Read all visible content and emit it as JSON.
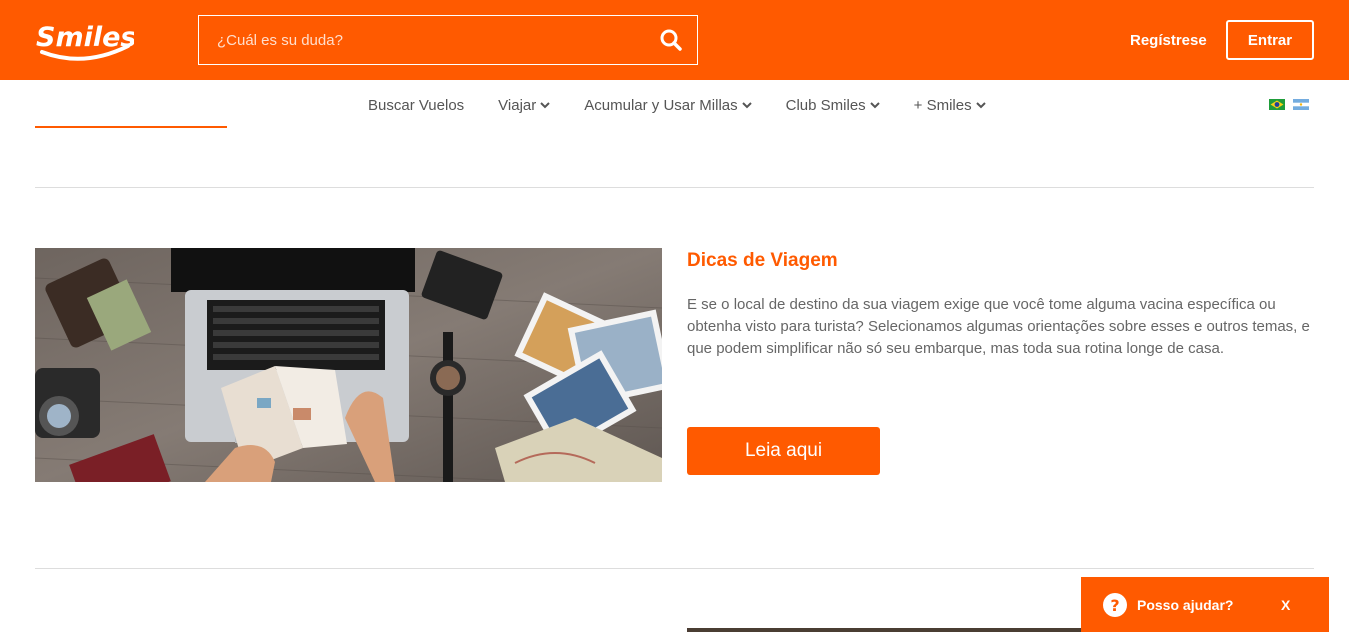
{
  "header": {
    "logo_text": "Smiles",
    "search_placeholder": "¿Cuál es su duda?",
    "register_label": "Regístrese",
    "enter_label": "Entrar"
  },
  "nav": {
    "items": [
      {
        "label": "Buscar Vuelos",
        "has_dropdown": false
      },
      {
        "label": "Viajar",
        "has_dropdown": true
      },
      {
        "label": "Acumular y Usar Millas",
        "has_dropdown": true
      },
      {
        "label": "Club Smiles",
        "has_dropdown": true
      },
      {
        "label": "+ Smiles",
        "has_dropdown": true
      }
    ],
    "flags": [
      "brazil-flag-icon",
      "argentina-flag-icon"
    ]
  },
  "article": {
    "title": "Dicas de Viagem",
    "body": "E se o local de destino da sua viagem exige que você tome alguma vacina específica ou obtenha visto para turista? Selecionamos algumas orientações sobre esses e outros temas, e que podem simplificar não só seu embarque, mas toda sua rotina longe de casa.",
    "button_label": "Leia aqui",
    "image": "travel-desk-laptop-passport-photo"
  },
  "help_widget": {
    "label": "Posso ajudar?",
    "close_label": "X"
  },
  "colors": {
    "brand_orange": "#ff5a00",
    "text_gray": "#666666",
    "divider": "#dddddd"
  }
}
